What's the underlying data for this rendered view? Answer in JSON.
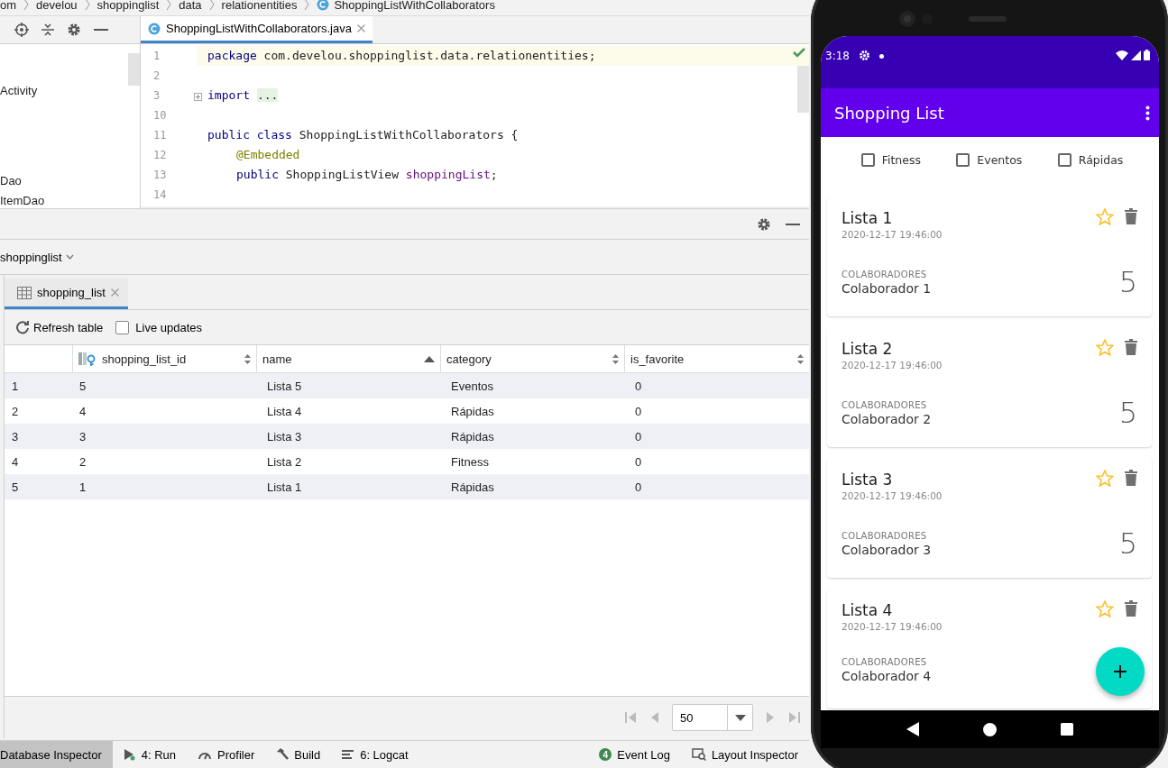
{
  "breadcrumbs": [
    "om",
    "develou",
    "shoppinglist",
    "data",
    "relationentities",
    "ShoppingListWithCollaborators"
  ],
  "project_panel": {
    "items": [
      "Activity",
      "Dao",
      "ItemDao"
    ]
  },
  "editor": {
    "tab": {
      "label": "ShoppingListWithCollaborators.java",
      "selected": true
    },
    "lines": [
      {
        "number": "1",
        "current": true,
        "tokens": [
          {
            "kind": "keyword",
            "text": "package"
          },
          {
            "kind": "plain",
            "text": " com.develou.shoppinglist.data.relationentities;"
          }
        ]
      },
      {
        "number": "2",
        "current": false
      },
      {
        "number": "3",
        "current": false,
        "folded": true,
        "tokens": [
          {
            "kind": "keyword",
            "text": "import"
          },
          {
            "kind": "folded",
            "text": "..."
          }
        ]
      },
      {
        "number": "10",
        "current": false
      },
      {
        "number": "11",
        "current": false,
        "tokens": [
          {
            "kind": "keyword",
            "text": "public class"
          },
          {
            "kind": "plain",
            "text": " ShoppingListWithCollaborators {"
          }
        ]
      },
      {
        "number": "12",
        "current": false,
        "indented": true,
        "tokens": [
          {
            "kind": "annotation",
            "text": "@Embedded"
          }
        ]
      },
      {
        "number": "13",
        "current": false,
        "indented": true,
        "tokens": [
          {
            "kind": "keyword",
            "text": "public"
          },
          {
            "kind": "plain",
            "text": " ShoppingListView "
          },
          {
            "kind": "field",
            "text": "shoppingList"
          },
          {
            "kind": "plain",
            "text": ";"
          }
        ]
      },
      {
        "number": "14",
        "current": false
      }
    ]
  },
  "database_inspector": {
    "database": "shoppinglist",
    "tab": {
      "label": "shopping_list",
      "selected": true
    },
    "toolbar": {
      "refresh": "Refresh table",
      "live_updates": {
        "label": "Live updates",
        "checked": false
      }
    },
    "table": {
      "columns": [
        {
          "label": "shopping_list_id",
          "kind": "key",
          "sorted_ascending": false
        },
        {
          "label": "name",
          "kind": "plain",
          "sorted_ascending": true
        },
        {
          "label": "category",
          "kind": "plain",
          "sorted_ascending": false
        },
        {
          "label": "is_favorite",
          "kind": "plain",
          "sorted_ascending": false
        }
      ],
      "rows": [
        {
          "number": "1",
          "cells": [
            "5",
            "Lista 5",
            "Eventos",
            "0"
          ]
        },
        {
          "number": "2",
          "cells": [
            "4",
            "Lista 4",
            "Rápidas",
            "0"
          ]
        },
        {
          "number": "3",
          "cells": [
            "3",
            "Lista 3",
            "Rápidas",
            "0"
          ]
        },
        {
          "number": "4",
          "cells": [
            "2",
            "Lista 2",
            "Fitness",
            "0"
          ]
        },
        {
          "number": "5",
          "cells": [
            "1",
            "Lista 1",
            "Rápidas",
            "0"
          ]
        }
      ]
    },
    "pagination": {
      "page_size": "50"
    }
  },
  "tool_windows": [
    {
      "label": "Database Inspector",
      "kind": "plain",
      "selected": true
    },
    {
      "label": "4: Run",
      "kind": "run",
      "selected": false
    },
    {
      "label": "Profiler",
      "kind": "profiler",
      "selected": false
    },
    {
      "label": "Build",
      "kind": "build",
      "selected": false
    },
    {
      "label": "6: Logcat",
      "kind": "logcat",
      "selected": false
    }
  ],
  "tool_windows_right": [
    {
      "label": "Event Log",
      "kind": "event",
      "badge": "4",
      "selected": false
    },
    {
      "label": "Layout Inspector",
      "kind": "layout",
      "selected": false
    }
  ],
  "phone": {
    "time": "3:18",
    "app_title": "Shopping List",
    "filters": [
      {
        "label": "Fitness",
        "checked": false
      },
      {
        "label": "Eventos",
        "checked": false
      },
      {
        "label": "Rápidas",
        "checked": false
      }
    ],
    "lists": [
      {
        "title": "Lista 1",
        "date": "2020-12-17 19:46:00",
        "collaborators_label": "COLABORADORES",
        "collaborator": "Colaborador 1",
        "count": "5",
        "favorite": false
      },
      {
        "title": "Lista 2",
        "date": "2020-12-17 19:46:00",
        "collaborators_label": "COLABORADORES",
        "collaborator": "Colaborador 2",
        "count": "5",
        "favorite": false
      },
      {
        "title": "Lista 3",
        "date": "2020-12-17 19:46:00",
        "collaborators_label": "COLABORADORES",
        "collaborator": "Colaborador 3",
        "count": "5",
        "favorite": false
      },
      {
        "title": "Lista 4",
        "date": "2020-12-17 19:46:00",
        "collaborators_label": "COLABORADORES",
        "collaborator": "Colaborador 4",
        "favorite": false
      }
    ]
  }
}
